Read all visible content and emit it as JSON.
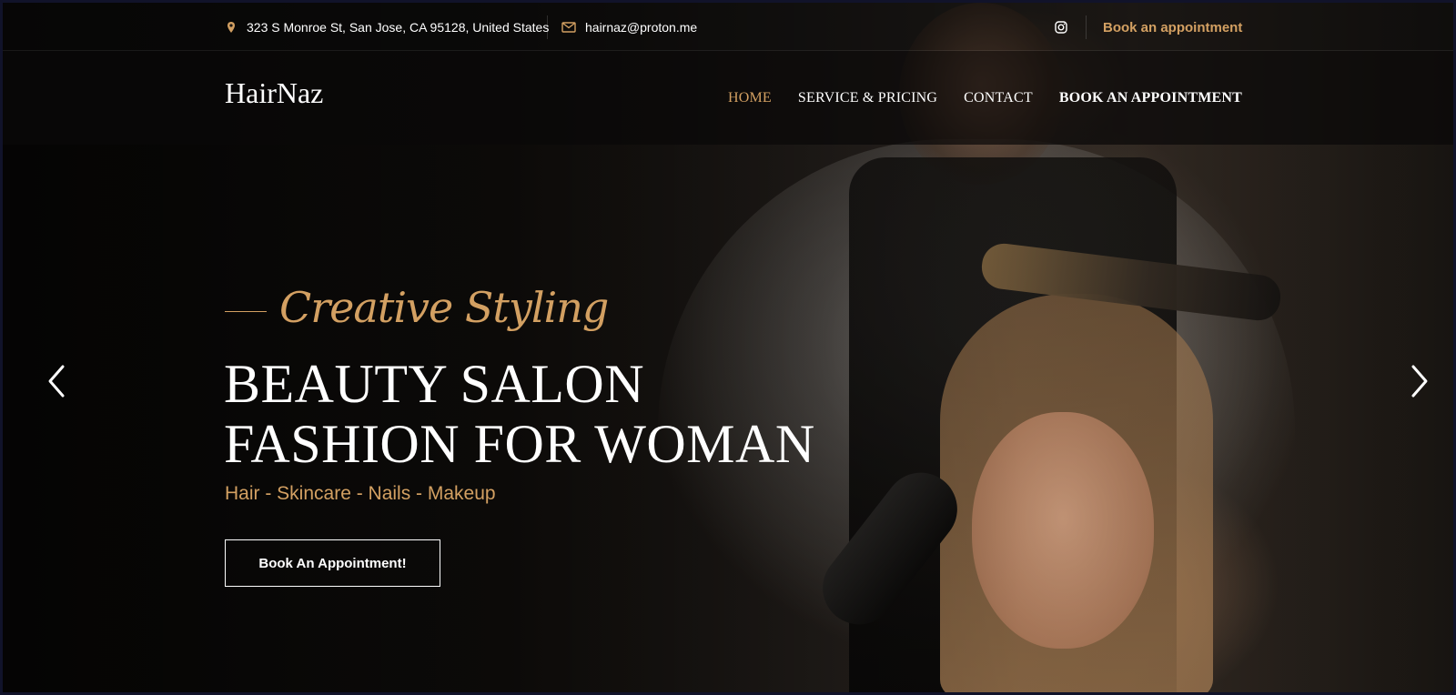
{
  "topbar": {
    "address": "323 S Monroe St, San Jose, CA 95128, United States",
    "email": "hairnaz@proton.me",
    "book_link": "Book an appointment",
    "address_icon": "map-pin-icon",
    "email_icon": "envelope-icon",
    "social_icon": "instagram-icon"
  },
  "navbar": {
    "logo": "HairNaz",
    "items": [
      {
        "label": "HOME",
        "active": true
      },
      {
        "label": "SERVICE & PRICING",
        "active": false
      },
      {
        "label": "CONTACT",
        "active": false
      },
      {
        "label": "BOOK AN APPOINTMENT",
        "active": false
      }
    ]
  },
  "hero": {
    "tagline": "Creative Styling",
    "headline_line1": "BEAUTY SALON",
    "headline_line2": "FASHION FOR WOMAN",
    "subtitle": "Hair - Skincare - Nails - Makeup",
    "cta": "Book An Appointment!",
    "prev_icon": "chevron-left-icon",
    "next_icon": "chevron-right-icon"
  },
  "colors": {
    "accent": "#d3a062",
    "text": "#ffffff"
  }
}
